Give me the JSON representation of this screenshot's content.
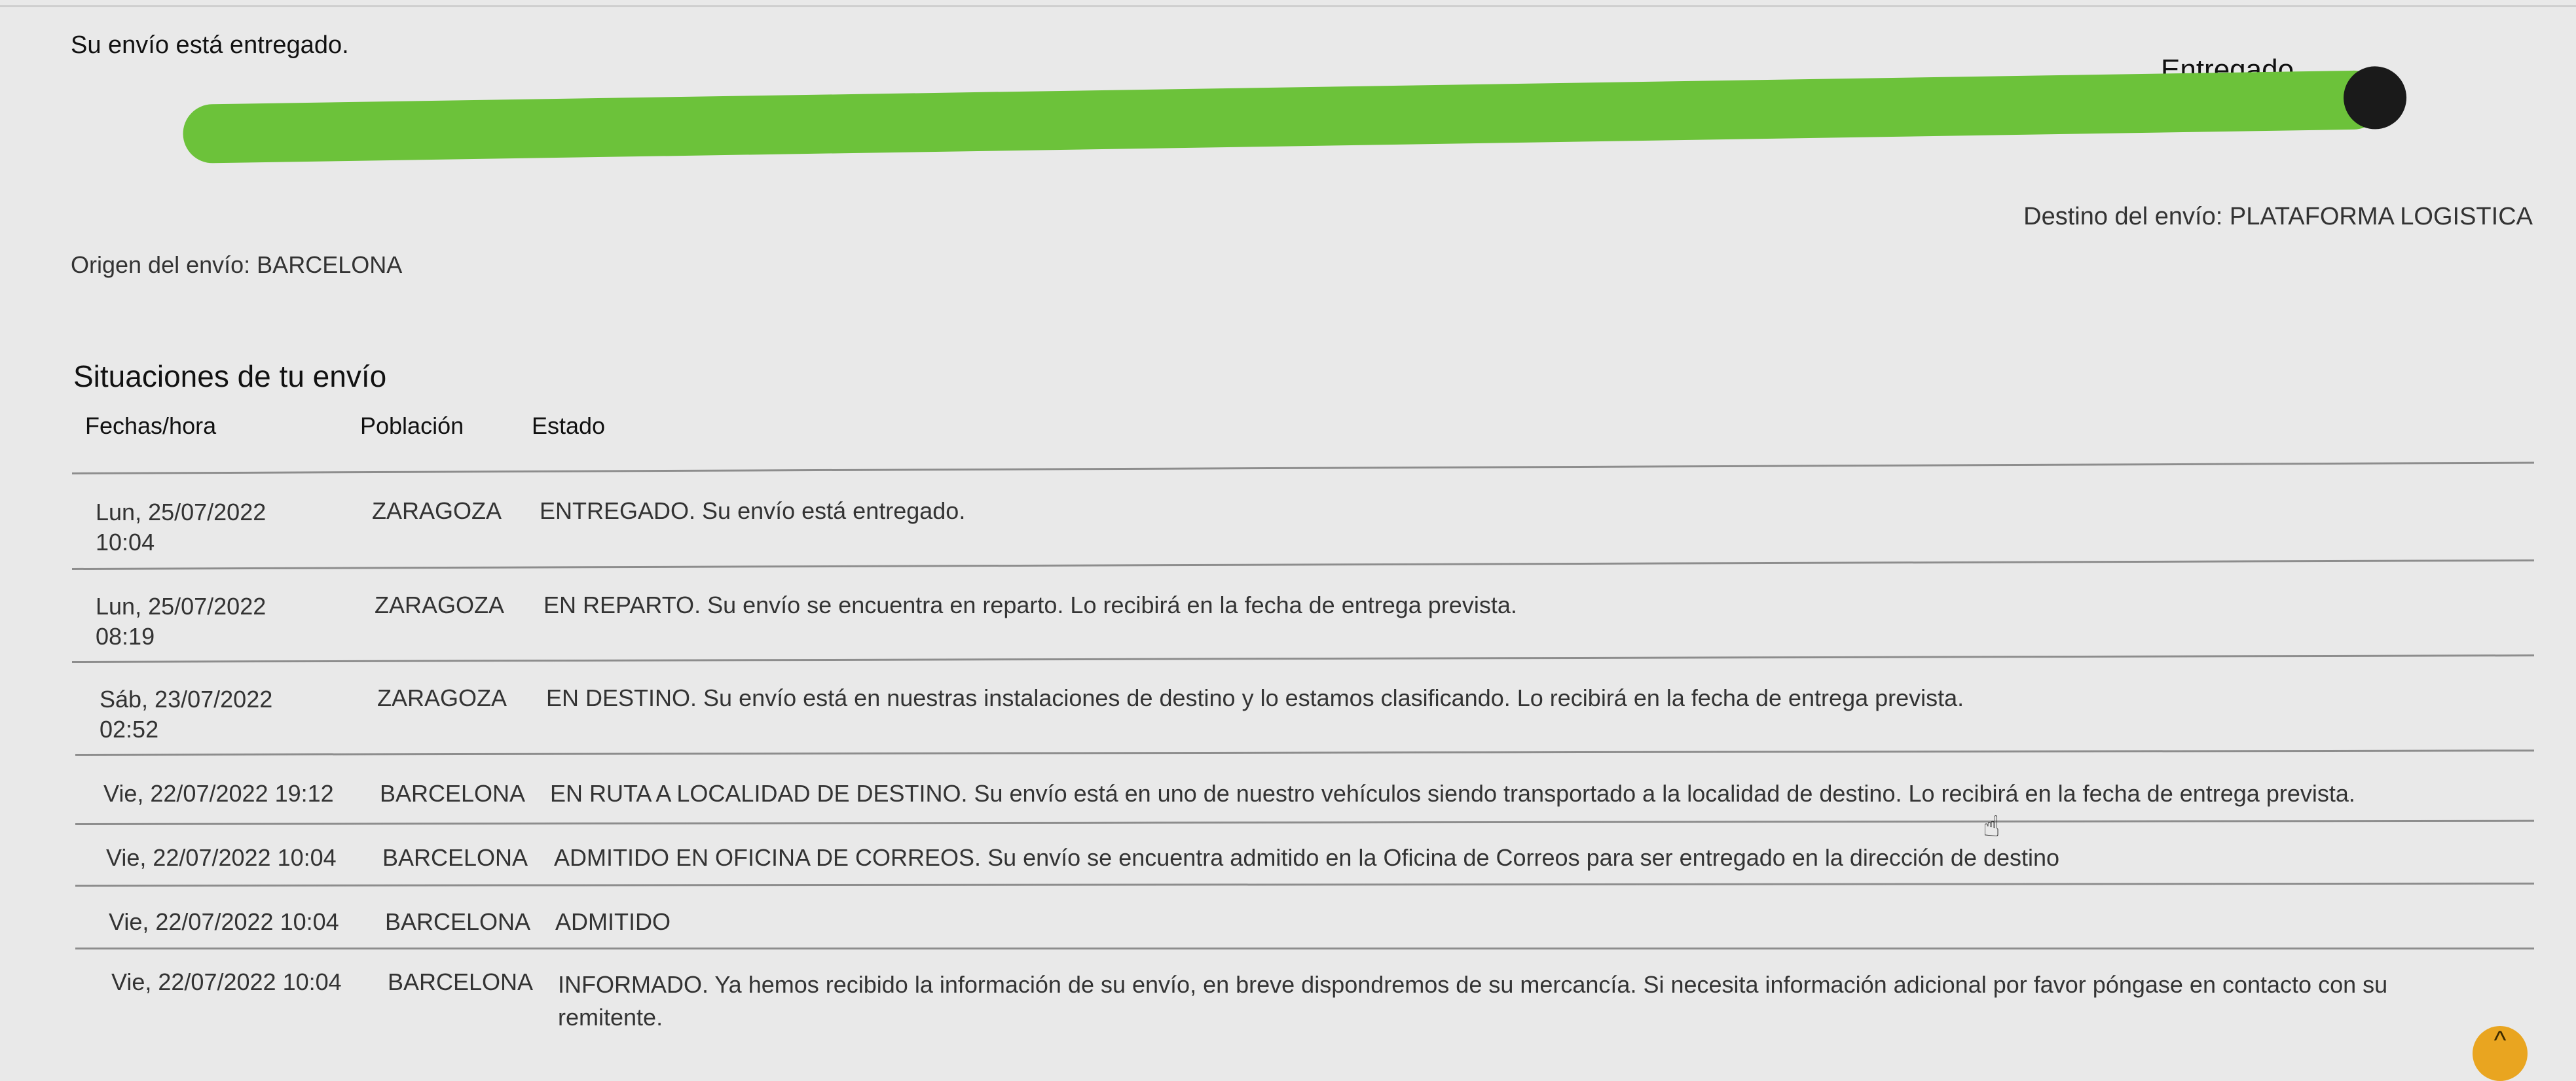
{
  "header": {
    "status_message": "Su envío está entregado.",
    "status_label": "Entregado",
    "progress_percent": 100,
    "progress_color": "#6cc23a"
  },
  "route": {
    "origin": "Origen del envío: BARCELONA",
    "destination": "Destino del envío: PLATAFORMA LOGISTICA"
  },
  "events": {
    "title": "Situaciones de tu envío",
    "columns": [
      "Fechas/hora",
      "Población",
      "Estado"
    ],
    "rows": [
      {
        "date": "Lun, 25/07/2022",
        "time": "10:04",
        "city": "ZARAGOZA",
        "status": "ENTREGADO. Su envío está entregado."
      },
      {
        "date": "Lun, 25/07/2022",
        "time": "08:19",
        "city": "ZARAGOZA",
        "status": "EN REPARTO. Su envío se encuentra en reparto. Lo recibirá en la fecha de entrega prevista."
      },
      {
        "date": "Sáb, 23/07/2022",
        "time": "02:52",
        "city": "ZARAGOZA",
        "status": "EN DESTINO. Su envío está en nuestras instalaciones de destino y lo estamos clasificando. Lo recibirá en la fecha de entrega prevista."
      },
      {
        "date": "Vie, 22/07/2022 19:12",
        "time": "",
        "city": "BARCELONA",
        "status": "EN RUTA A LOCALIDAD DE DESTINO. Su envío está en uno de nuestro vehículos siendo transportado a la localidad de destino. Lo recibirá en la fecha de entrega prevista."
      },
      {
        "date": "Vie, 22/07/2022 10:04",
        "time": "",
        "city": "BARCELONA",
        "status": "ADMITIDO EN OFICINA DE CORREOS. Su envío se encuentra admitido en la Oficina de Correos para ser entregado en la dirección de destino"
      },
      {
        "date": "Vie, 22/07/2022 10:04",
        "time": "",
        "city": "BARCELONA",
        "status": "ADMITIDO"
      },
      {
        "date": "Vie, 22/07/2022 10:04",
        "time": "",
        "city": "BARCELONA",
        "status": "INFORMADO. Ya hemos recibido la información de su envío, en breve dispondremos de su mercancía. Si necesita información adicional por favor póngase en contacto con su remitente."
      }
    ]
  },
  "controls": {
    "scroll_top_icon": "chevron-up-icon",
    "cursor_icon": "hand-pointer-icon"
  }
}
